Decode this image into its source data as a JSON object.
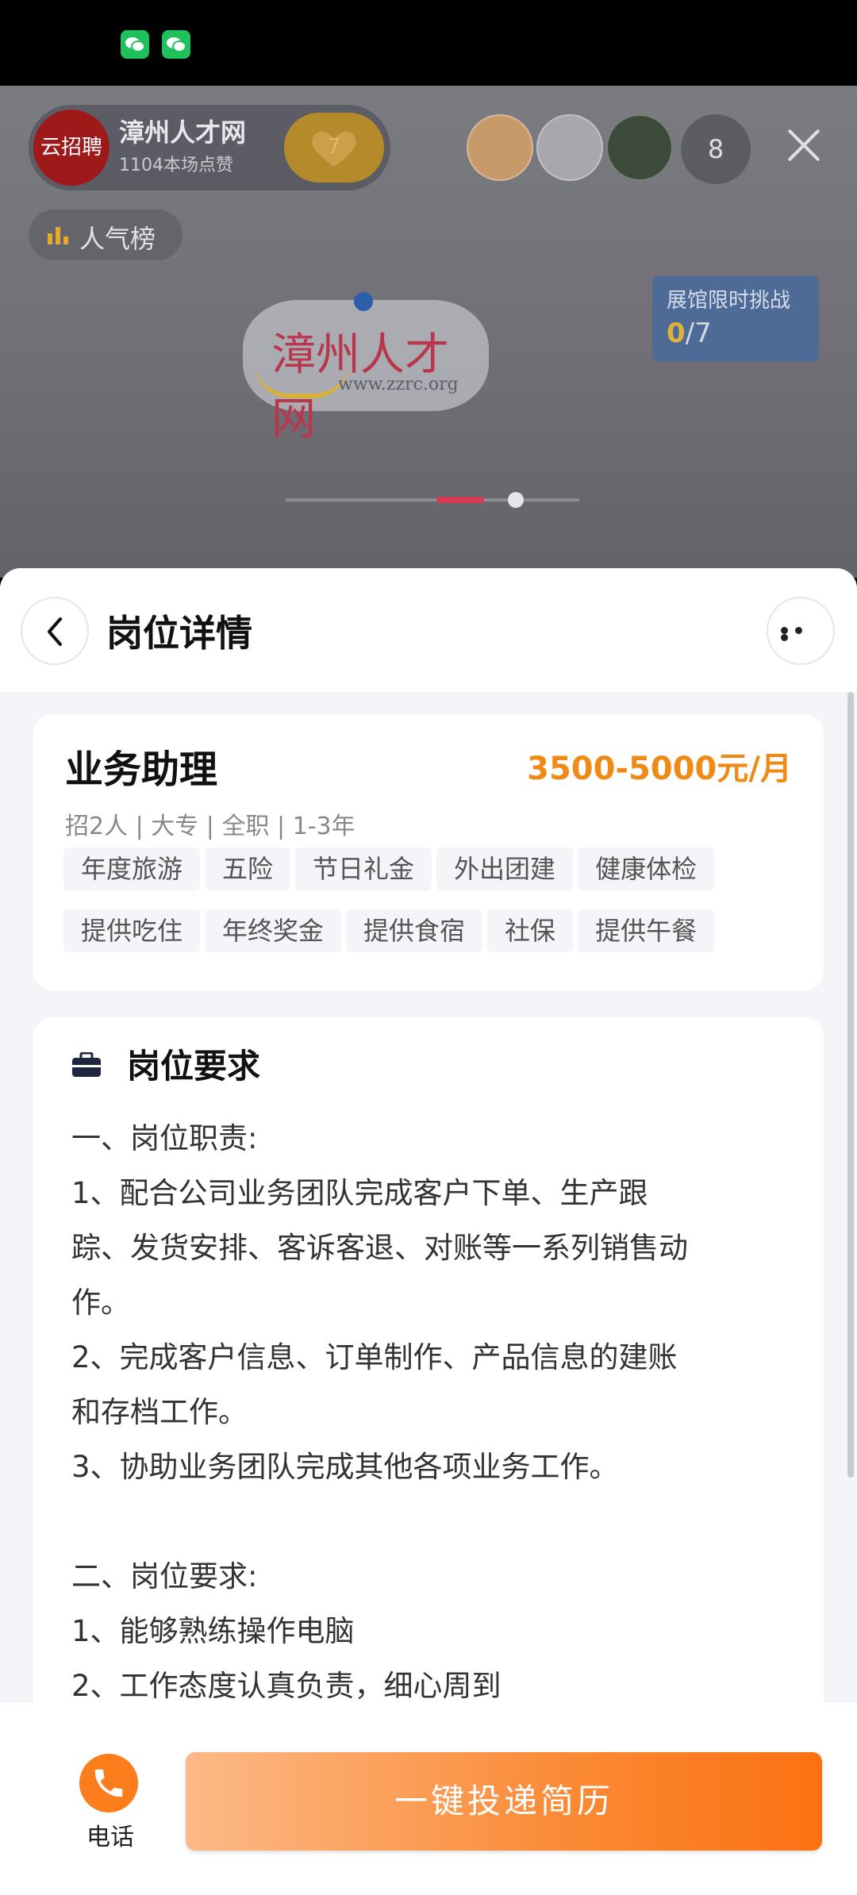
{
  "live": {
    "host_name": "漳州人才网",
    "host_avatar_text": "云招聘",
    "likes": "1104本场点赞",
    "heart_count": "7",
    "viewer_count": "8",
    "rank_label": "人气榜",
    "challenge_title": "展馆限时挑战",
    "challenge_done": "0",
    "challenge_total": "/7",
    "logo_text": "漳州人才网",
    "logo_url": "www.zzrc.org"
  },
  "sheet": {
    "title": "岗位详情"
  },
  "job": {
    "title": "业务助理",
    "salary": "3500-5000元/月",
    "meta": "招2人 | 大专 | 全职 | 1-3年",
    "tags": [
      "年度旅游",
      "五险",
      "节日礼金",
      "外出团建",
      "健康体检",
      "提供吃住",
      "年终奖金",
      "提供食宿",
      "社保",
      "提供午餐"
    ]
  },
  "requirements": {
    "title": "岗位要求",
    "lines": [
      "一、岗位职责:",
      "1、配合公司业务团队完成客户下单、生产跟",
      "踪、发货安排、客诉客退、对账等一系列销售动",
      "作。",
      "2、完成客户信息、订单制作、产品信息的建账",
      "和存档工作。",
      "3、协助业务团队完成其他各项业务工作。",
      "",
      "二、岗位要求:",
      "1、能够熟练操作电脑",
      "2、工作态度认真负责，细心周到"
    ]
  },
  "actions": {
    "phone_label": "电话",
    "apply_label": "一键投递简历"
  },
  "colors": {
    "accent": "#f08a17",
    "button_orange": "#fb7112",
    "wechat_green": "#1fc15c"
  }
}
